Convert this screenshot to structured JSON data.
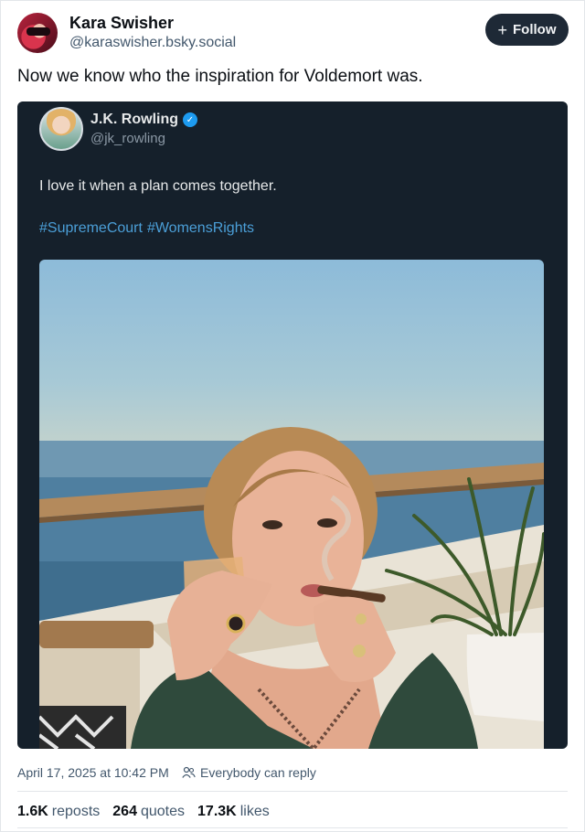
{
  "post": {
    "author_name": "Kara Swisher",
    "author_handle": "@karaswisher.bsky.social",
    "follow_label": "Follow",
    "text": "Now we know who the inspiration for Voldemort was."
  },
  "quoted": {
    "name": "J.K. Rowling",
    "handle": "@jk_rowling",
    "text": "I love it when a plan comes together.",
    "hashtags": [
      "#SupremeCourt",
      "#WomensRights"
    ]
  },
  "meta": {
    "timestamp": "April 17, 2025 at 10:42 PM",
    "reply_setting": "Everybody can reply"
  },
  "stats": {
    "reposts_count": "1.6K",
    "reposts_label": "reposts",
    "quotes_count": "264",
    "quotes_label": "quotes",
    "likes_count": "17.3K",
    "likes_label": "likes"
  },
  "colors": {
    "card_bg": "#15202b",
    "hashtag": "#4b9fd8",
    "verified": "#1d9bf0",
    "follow_bg": "#1e2936"
  }
}
